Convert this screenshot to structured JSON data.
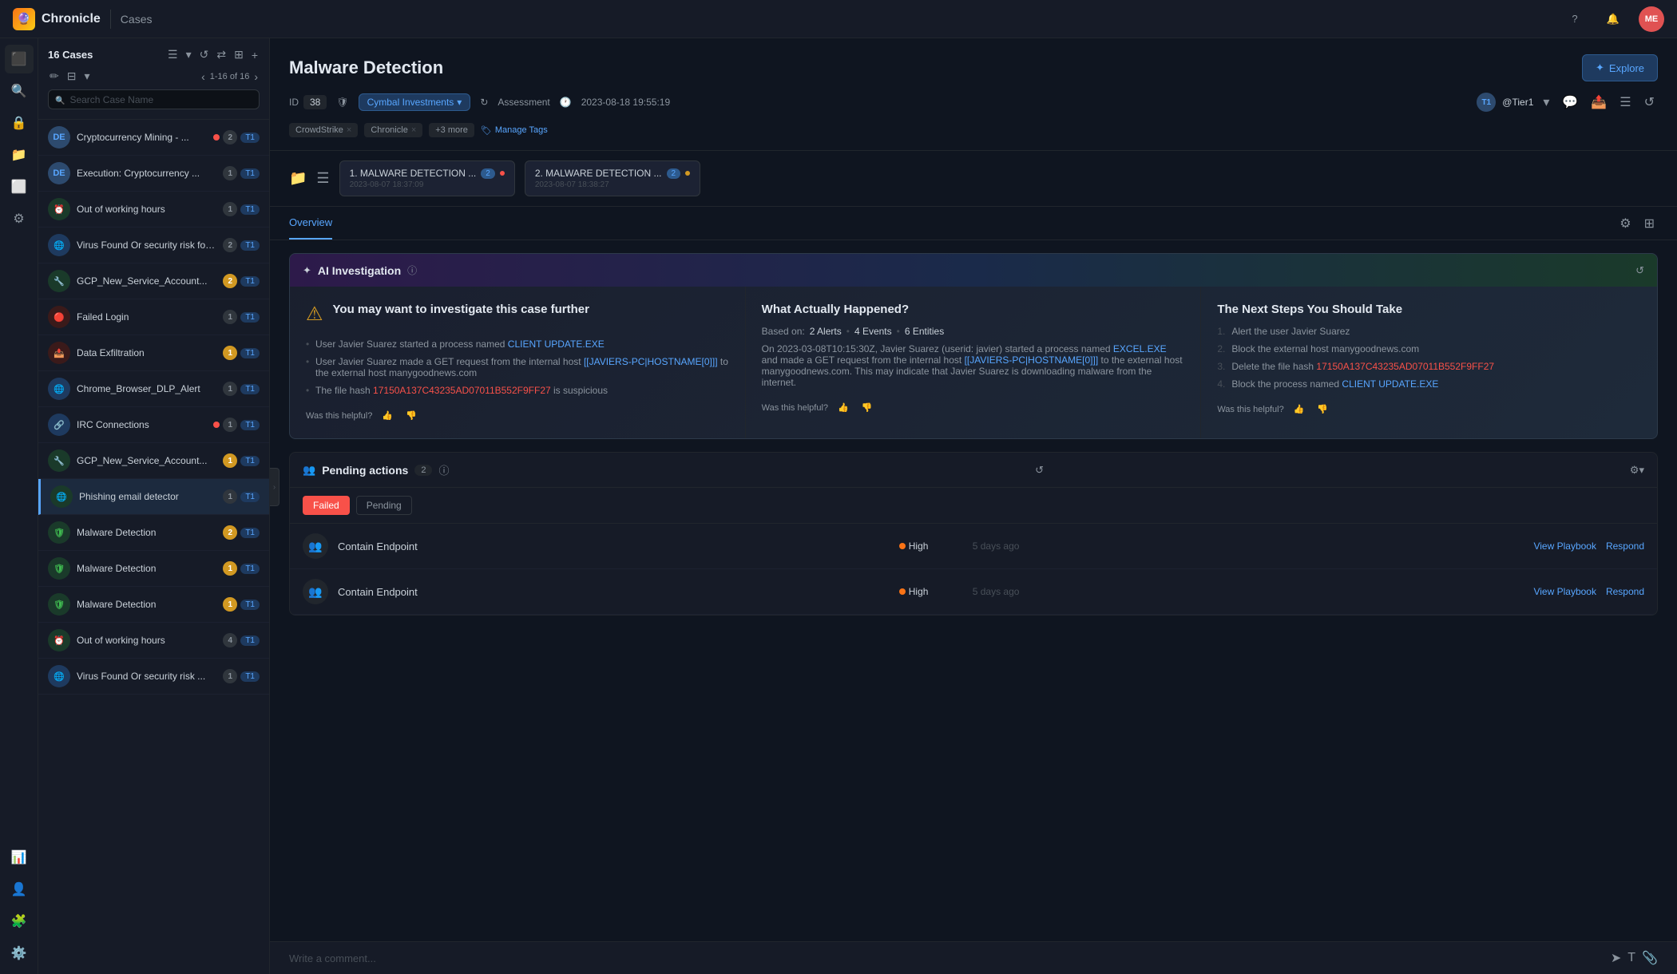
{
  "app": {
    "name": "Chronicle",
    "page": "Cases"
  },
  "nav": {
    "help_label": "?",
    "user_initials": "ME"
  },
  "sidebar": {
    "icons": [
      "dashboard",
      "search",
      "lock",
      "briefcase",
      "layers",
      "settings",
      "chart",
      "person",
      "puzzle",
      "gear"
    ]
  },
  "cases_panel": {
    "title": "16 Cases",
    "pagination": "1-16 of 16",
    "search_placeholder": "Search Case Name",
    "items": [
      {
        "id": 1,
        "icon_text": "DE",
        "icon_type": "de",
        "name": "Cryptocurrency Mining - ...",
        "dot": "red",
        "group_badge": "2",
        "tier": "T1"
      },
      {
        "id": 2,
        "icon_text": "DE",
        "icon_type": "de",
        "name": "Execution: Cryptocurrency ...",
        "group_badge": "1",
        "tier": "T1"
      },
      {
        "id": 3,
        "icon_text": "⏰",
        "icon_type": "green",
        "name": "Out of working hours",
        "group_badge": "1",
        "tier": "T1"
      },
      {
        "id": 4,
        "icon_text": "🌐",
        "icon_type": "blue",
        "name": "Virus Found Or security risk fou...",
        "group_badge": "2",
        "tier": "T1"
      },
      {
        "id": 5,
        "icon_text": "🔧",
        "icon_type": "green",
        "name": "GCP_New_Service_Account...",
        "group_badge": "2",
        "tier": "T1"
      },
      {
        "id": 6,
        "icon_text": "🔴",
        "icon_type": "red",
        "name": "Failed Login",
        "group_badge": "1",
        "tier": "T1"
      },
      {
        "id": 7,
        "icon_text": "📤",
        "icon_type": "red",
        "name": "Data Exfiltration",
        "group_badge": "1",
        "tier": "T1"
      },
      {
        "id": 8,
        "icon_text": "🌐",
        "icon_type": "blue",
        "name": "Chrome_Browser_DLP_Alert",
        "group_badge": "1",
        "tier": "T1"
      },
      {
        "id": 9,
        "icon_text": "🔗",
        "icon_type": "blue",
        "name": "IRC Connections",
        "dot": "red",
        "group_badge": "1",
        "tier": "T1"
      },
      {
        "id": 10,
        "icon_text": "🔧",
        "icon_type": "green",
        "name": "GCP_New_Service_Account...",
        "group_badge": "1",
        "tier": "T1"
      },
      {
        "id": 11,
        "icon_text": "🌐",
        "icon_type": "green",
        "name": "Phishing email detector",
        "group_badge": "1",
        "tier": "T1",
        "active": true
      },
      {
        "id": 12,
        "icon_text": "🛡",
        "icon_type": "green",
        "name": "Malware Detection",
        "group_badge": "2",
        "tier": "T1"
      },
      {
        "id": 13,
        "icon_text": "🛡",
        "icon_type": "green",
        "name": "Malware Detection",
        "group_badge": "1",
        "tier": "T1"
      },
      {
        "id": 14,
        "icon_text": "🛡",
        "icon_type": "green",
        "name": "Malware Detection",
        "group_badge": "1",
        "tier": "T1"
      },
      {
        "id": 15,
        "icon_text": "⏰",
        "icon_type": "green",
        "name": "Out of working hours",
        "group_badge": "4",
        "tier": "T1"
      },
      {
        "id": 16,
        "icon_text": "🌐",
        "icon_type": "blue",
        "name": "Virus Found Or security risk ...",
        "group_badge": "1",
        "tier": "T1"
      }
    ]
  },
  "case_detail": {
    "title": "Malware Detection",
    "id": "38",
    "org": "Cymbal Investments",
    "assessment": "Assessment",
    "timestamp": "2023-08-18 19:55:19",
    "assignee_initials": "T1",
    "assignee_name": "@Tier1",
    "tags": [
      "CrowdStrike",
      "Chronicle"
    ],
    "more_tags": "+3 more",
    "manage_tags_label": "Manage Tags",
    "explore_label": "Explore",
    "alerts": [
      {
        "title": "1. MALWARE DETECTION ...",
        "count": "2",
        "time": "2023-08-07 18:37:09",
        "severity": "high"
      },
      {
        "title": "2. MALWARE DETECTION ...",
        "count": "2",
        "time": "2023-08-07 18:38:27",
        "severity": "medium"
      }
    ],
    "overview_tab": "Overview",
    "ai_investigation": {
      "title": "AI Investigation",
      "col1": {
        "heading": "You may want to investigate this case further",
        "bullets": [
          {
            "text": "User Javier Suarez started a process named ",
            "link": "CLIENT UPDATE.EXE",
            "suffix": ""
          },
          {
            "text": "User Javier Suarez made a GET request from the internal host ",
            "link": "[[JAVIERS-PC|HOSTNAME[0]]]",
            "suffix": " to the external host manygoodnews.com"
          },
          {
            "text": "The file hash ",
            "link": "17150A137C43235AD07011B552F9FF27",
            "suffix": " is suspicious"
          }
        ],
        "helpful_label": "Was this helpful?"
      },
      "col2": {
        "heading": "What Actually Happened?",
        "based_on_label": "Based on:",
        "alerts": "2 Alerts",
        "events": "4 Events",
        "entities": "6 Entities",
        "body": "On 2023-03-08T10:15:30Z, Javier Suarez (userid: javier) started a process named EXCEL.EXE and made a GET request from the internal host [[JAVIERS-PC|HOSTNAME[0]]] to the external host manygoodnews.com. This may indicate that Javier Suarez is downloading malware from the internet.",
        "helpful_label": "Was this helpful?"
      },
      "col3": {
        "heading": "The Next Steps You Should Take",
        "steps": [
          {
            "num": "1.",
            "text": "Alert the user Javier Suarez"
          },
          {
            "num": "2.",
            "text": "Block the external host manygoodnews.com"
          },
          {
            "num": "3.",
            "text": "Delete the file hash ",
            "link": "17150A137C43235AD07011B552F9FF27"
          },
          {
            "num": "4.",
            "text": "Block the process named ",
            "link": "CLIENT UPDATE.EXE"
          }
        ],
        "helpful_label": "Was this helpful?"
      }
    },
    "pending_actions": {
      "title": "Pending actions",
      "count": "2",
      "filters": [
        "Failed",
        "Pending"
      ],
      "active_filter": "Failed",
      "actions": [
        {
          "name": "Contain Endpoint",
          "priority": "High",
          "time": "5 days ago",
          "view_playbook": "View Playbook",
          "respond": "Respond"
        },
        {
          "name": "Contain Endpoint",
          "priority": "High",
          "time": "5 days ago",
          "view_playbook": "View Playbook",
          "respond": "Respond"
        }
      ]
    },
    "comment_placeholder": "Write a comment..."
  }
}
